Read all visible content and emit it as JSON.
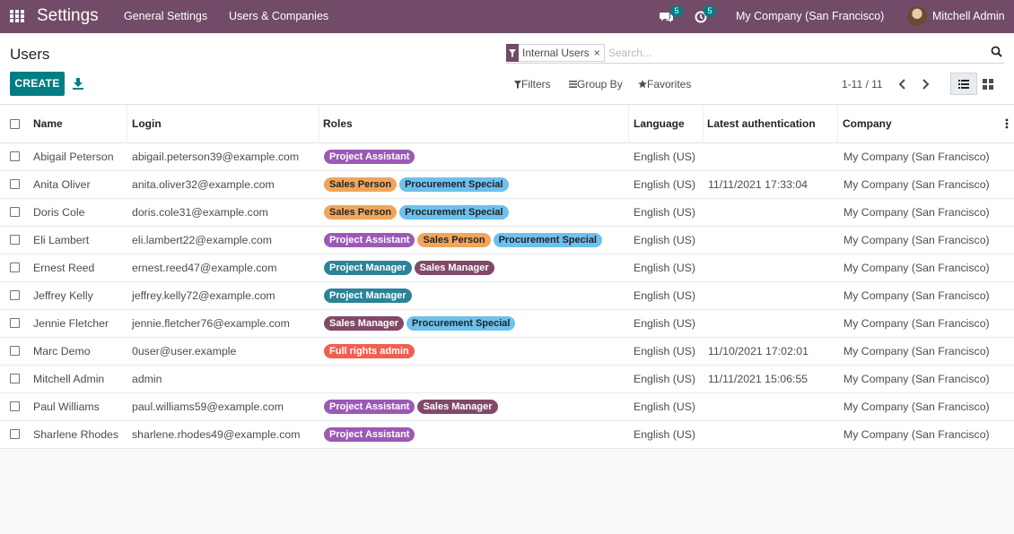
{
  "navbar": {
    "app_title": "Settings",
    "menu": [
      "General Settings",
      "Users & Companies"
    ],
    "chat_count": "5",
    "activity_count": "5",
    "company": "My Company (San Francisco)",
    "user": "Mitchell Admin"
  },
  "control": {
    "title": "Users",
    "create_label": "CREATE",
    "facet_label": "Internal Users",
    "facet_close": "×",
    "search_placeholder": "Search...",
    "filters_label": "Filters",
    "groupby_label": "Group By",
    "favorites_label": "Favorites",
    "pager": "1-11 / 11"
  },
  "colors": {
    "brand": "#714b67",
    "primary": "#017e84",
    "tag_project_assistant": "#9b59b6",
    "tag_sales_person": "#f0a55b",
    "tag_procurement_special": "#6cc1ed",
    "tag_project_manager": "#2c8397",
    "tag_sales_manager": "#814968",
    "tag_full_rights_admin": "#f06050"
  },
  "table": {
    "headers": {
      "name": "Name",
      "login": "Login",
      "roles": "Roles",
      "language": "Language",
      "latest_auth": "Latest authentication",
      "company": "Company"
    },
    "rows": [
      {
        "name": "Abigail Peterson",
        "login": "abigail.peterson39@example.com",
        "roles": [
          "Project Assistant"
        ],
        "language": "English (US)",
        "latest_auth": "",
        "company": "My Company (San Francisco)"
      },
      {
        "name": "Anita Oliver",
        "login": "anita.oliver32@example.com",
        "roles": [
          "Sales Person",
          "Procurement Special"
        ],
        "language": "English (US)",
        "latest_auth": "11/11/2021 17:33:04",
        "company": "My Company (San Francisco)"
      },
      {
        "name": "Doris Cole",
        "login": "doris.cole31@example.com",
        "roles": [
          "Sales Person",
          "Procurement Special"
        ],
        "language": "English (US)",
        "latest_auth": "",
        "company": "My Company (San Francisco)"
      },
      {
        "name": "Eli Lambert",
        "login": "eli.lambert22@example.com",
        "roles": [
          "Project Assistant",
          "Sales Person",
          "Procurement Special"
        ],
        "language": "English (US)",
        "latest_auth": "",
        "company": "My Company (San Francisco)"
      },
      {
        "name": "Ernest Reed",
        "login": "ernest.reed47@example.com",
        "roles": [
          "Project Manager",
          "Sales Manager"
        ],
        "language": "English (US)",
        "latest_auth": "",
        "company": "My Company (San Francisco)"
      },
      {
        "name": "Jeffrey Kelly",
        "login": "jeffrey.kelly72@example.com",
        "roles": [
          "Project Manager"
        ],
        "language": "English (US)",
        "latest_auth": "",
        "company": "My Company (San Francisco)"
      },
      {
        "name": "Jennie Fletcher",
        "login": "jennie.fletcher76@example.com",
        "roles": [
          "Sales Manager",
          "Procurement Special"
        ],
        "language": "English (US)",
        "latest_auth": "",
        "company": "My Company (San Francisco)"
      },
      {
        "name": "Marc Demo",
        "login": "0user@user.example",
        "roles": [
          "Full rights admin"
        ],
        "language": "English (US)",
        "latest_auth": "11/10/2021 17:02:01",
        "company": "My Company (San Francisco)"
      },
      {
        "name": "Mitchell Admin",
        "login": "admin",
        "roles": [],
        "language": "English (US)",
        "latest_auth": "11/11/2021 15:06:55",
        "company": "My Company (San Francisco)"
      },
      {
        "name": "Paul Williams",
        "login": "paul.williams59@example.com",
        "roles": [
          "Project Assistant",
          "Sales Manager"
        ],
        "language": "English (US)",
        "latest_auth": "",
        "company": "My Company (San Francisco)"
      },
      {
        "name": "Sharlene Rhodes",
        "login": "sharlene.rhodes49@example.com",
        "roles": [
          "Project Assistant"
        ],
        "language": "English (US)",
        "latest_auth": "",
        "company": "My Company (San Francisco)"
      }
    ]
  }
}
